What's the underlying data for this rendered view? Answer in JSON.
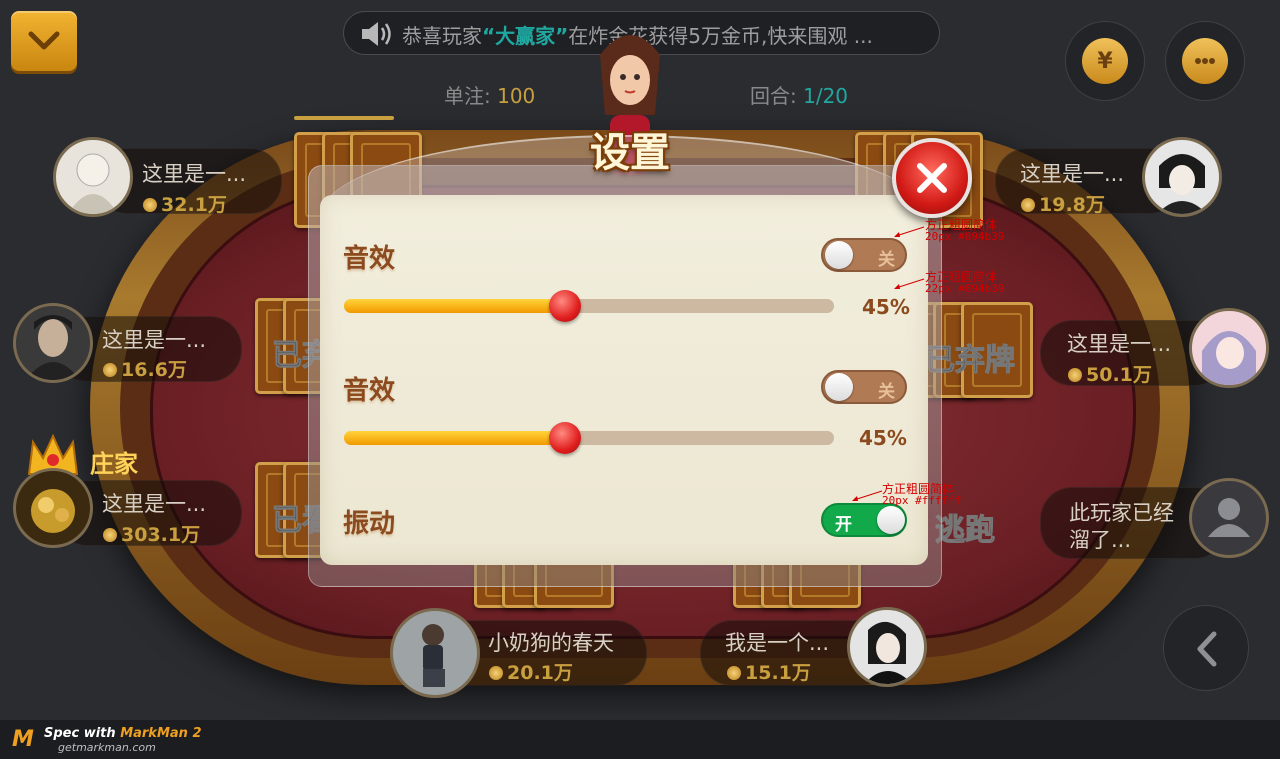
{
  "announcement": {
    "prefix": "恭喜玩家",
    "highlight": "“大赢家”",
    "suffix": "在炸金花获得5万金币,快来围观 ..."
  },
  "game_info": {
    "bet_label": "单注:",
    "bet_value": "100",
    "round_label": "回合:",
    "round_value": "1/20"
  },
  "top_buttons": {
    "bag_symbol": "¥"
  },
  "players": [
    {
      "name": "这里是一...",
      "coins": "32.1万"
    },
    {
      "name": "这里是一...",
      "coins": "16.6万"
    },
    {
      "name": "这里是一...",
      "coins": "303.1万",
      "role": "庄家"
    },
    {
      "name": "小奶狗的春天",
      "coins": "20.1万"
    },
    {
      "name": "我是一个...",
      "coins": "15.1万"
    },
    {
      "name": "这里是一...",
      "coins": "19.8万"
    },
    {
      "name": "这里是一...",
      "coins": "50.1万"
    },
    {
      "name": "此玩家已经溜了..."
    }
  ],
  "status_tags": {
    "left_top": "已弃",
    "left_bottom": "已看",
    "right_top": "已弃牌",
    "right_bottom": "逃跑"
  },
  "settings_dialog": {
    "title": "设置",
    "rows": [
      {
        "label": "音效",
        "toggle_text": "关",
        "toggle_on": false,
        "volume_fraction": 0.45,
        "volume_text": "45%"
      },
      {
        "label": "音效",
        "toggle_text": "关",
        "toggle_on": false,
        "volume_fraction": 0.45,
        "volume_text": "45%"
      },
      {
        "label": "振动",
        "toggle_text": "开",
        "toggle_on": true
      }
    ]
  },
  "annotations": [
    {
      "font": "方正粗圆简体",
      "spec": "20px  #894b39"
    },
    {
      "font": "方正粗圆简体",
      "spec": "22px  #894b39"
    },
    {
      "font": "方正粗圆简体",
      "spec": "20px  #ffffff"
    }
  ],
  "footer": {
    "logo": "M",
    "prefix": "Spec with ",
    "brand": "MarkMan 2",
    "url": "getmarkman.com"
  },
  "colors": {
    "accent_gold": "#c9a040",
    "accent_teal": "#1fa8a0",
    "label_brown": "#894b39",
    "toggle_on": "#11a94a"
  }
}
